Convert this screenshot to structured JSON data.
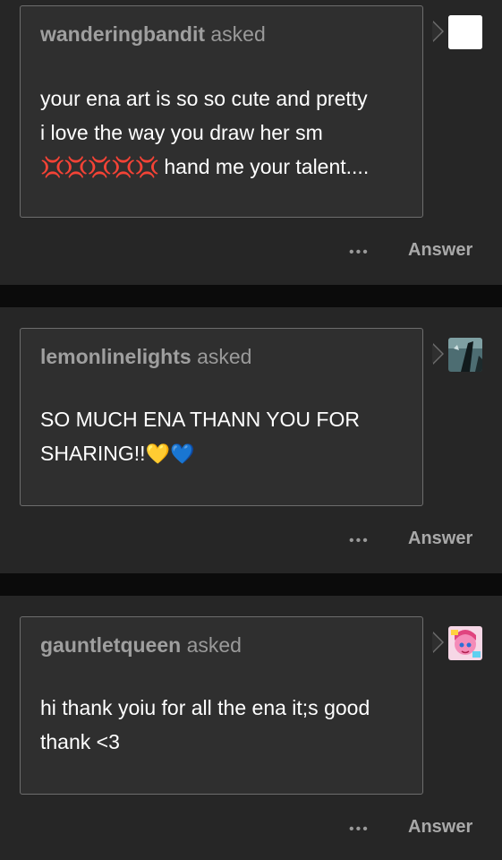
{
  "posts": [
    {
      "username": "wanderingbandit",
      "asked": "asked",
      "line1": "your ena art is so so cute and pretty",
      "line2": "i love the way you draw her sm",
      "emoji": "💢💢💢💢💢",
      "line3_tail": " hand me your talent....",
      "avatar_icon": "blank-white-avatar",
      "more": "•••",
      "answer": "Answer"
    },
    {
      "username": "lemonlinelights",
      "asked": "asked",
      "line1": "SO MUCH ENA THANN YOU FOR",
      "line2_text": "SHARING!!",
      "emoji": "💛💙",
      "avatar_icon": "dark-teal-avatar",
      "more": "•••",
      "answer": "Answer"
    },
    {
      "username": "gauntletqueen",
      "asked": "asked",
      "line1": "hi thank yoiu for all the ena it;s good",
      "line2": "thank <3",
      "avatar_icon": "pink-anime-avatar",
      "more": "•••",
      "answer": "Answer"
    }
  ],
  "colors": {
    "page_bg": "#0b0b0b",
    "card_bg": "#262626",
    "bubble_bg": "#2f2f2f",
    "bubble_border": "#6d6d6d",
    "muted_text": "#9a9a9a",
    "anger_red": "#d7262d"
  }
}
